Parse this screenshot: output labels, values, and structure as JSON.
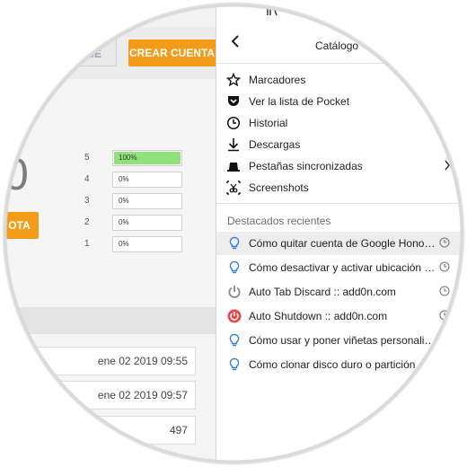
{
  "background": {
    "login_label": "SE",
    "create_account_label": "CREAR CUENTA",
    "score": "0",
    "vote_label": "OTA",
    "ratings": [
      {
        "star": "5",
        "percent": "100%",
        "fill": 1.0
      },
      {
        "star": "4",
        "percent": "0%",
        "fill": 0
      },
      {
        "star": "3",
        "percent": "0%",
        "fill": 0
      },
      {
        "star": "2",
        "percent": "0%",
        "fill": 0
      },
      {
        "star": "1",
        "percent": "0%",
        "fill": 0
      }
    ],
    "rows": [
      {
        "value": "ene 02 2019 09:55"
      },
      {
        "value": "ene 02 2019 09:57"
      },
      {
        "value": "497"
      }
    ]
  },
  "menu": {
    "title": "Catálogo",
    "items": [
      {
        "label": "Marcadores",
        "icon": "star-icon"
      },
      {
        "label": "Ver la lista de Pocket",
        "icon": "pocket-icon"
      },
      {
        "label": "Historial",
        "icon": "history-clock-icon"
      },
      {
        "label": "Descargas",
        "icon": "download-icon"
      },
      {
        "label": "Pestañas sincronizadas",
        "icon": "synced-tabs-icon",
        "has_submenu": true
      },
      {
        "label": "Screenshots",
        "icon": "screenshots-icon"
      }
    ],
    "recent_header": "Destacados recientes",
    "recent": [
      {
        "label": "Cómo quitar cuenta de Google Honor…",
        "icon": "lightbulb-icon",
        "hover": true
      },
      {
        "label": "Cómo desactivar y activar ubicación G…",
        "icon": "lightbulb-icon"
      },
      {
        "label": "Auto Tab Discard :: add0n.com",
        "icon": "power-gray-icon"
      },
      {
        "label": "Auto Shutdown :: add0n.com",
        "icon": "power-red-icon"
      },
      {
        "label": "Cómo usar y poner viñetas personaliz…",
        "icon": "lightbulb-icon"
      },
      {
        "label": "Cómo clonar disco duro o partición",
        "icon": "lightbulb-icon"
      }
    ]
  },
  "colors": {
    "accent_orange": "#f39c1a",
    "progress_green": "#8fe27a",
    "power_red": "#e5484d",
    "bulb_blue": "#2f7fd6"
  }
}
